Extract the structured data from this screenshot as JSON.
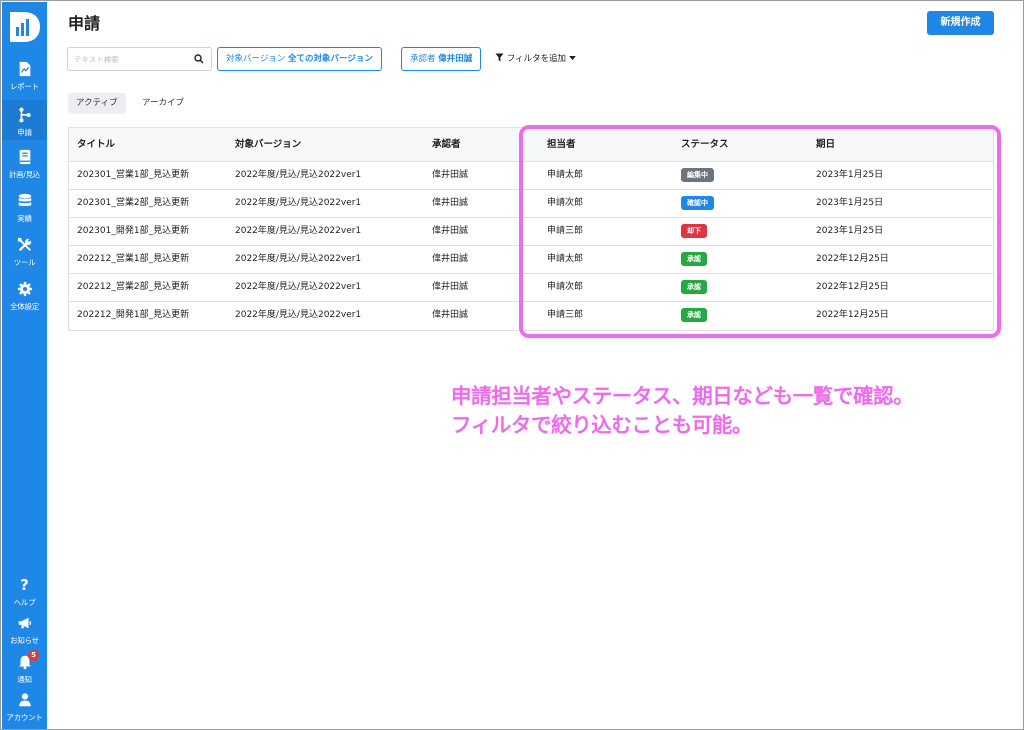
{
  "sidebar": {
    "logo": "D",
    "items": [
      {
        "label": "レポート",
        "icon": "report-icon"
      },
      {
        "label": "申請",
        "icon": "branch-icon",
        "active": true
      },
      {
        "label": "計画/見込",
        "icon": "book-icon"
      },
      {
        "label": "実績",
        "icon": "database-icon"
      },
      {
        "label": "ツール",
        "icon": "tools-icon"
      },
      {
        "label": "全体設定",
        "icon": "gear-icon"
      }
    ],
    "bottom_items": [
      {
        "label": "ヘルプ",
        "icon": "question-icon"
      },
      {
        "label": "お知らせ",
        "icon": "megaphone-icon"
      },
      {
        "label": "通知",
        "icon": "bell-icon",
        "badge": "5"
      },
      {
        "label": "アカウント",
        "icon": "user-icon"
      }
    ]
  },
  "header": {
    "title": "申請",
    "new_button": "新規作成"
  },
  "filters": {
    "search_placeholder": "テキスト検索",
    "target_version_label": "対象バージョン",
    "target_version_value": "全ての対象バージョン",
    "approver_label": "承認者",
    "approver_value": "偉井田誠",
    "add_filter": "フィルタを追加"
  },
  "tabs": [
    {
      "label": "アクティブ",
      "active": true
    },
    {
      "label": "アーカイブ",
      "active": false
    }
  ],
  "table": {
    "headers": [
      "タイトル",
      "対象バージョン",
      "承認者",
      "担当者",
      "ステータス",
      "期日"
    ],
    "rows": [
      {
        "title": "202301_営業1部_見込更新",
        "version": "2022年度/見込/見込2022ver1",
        "approver": "偉井田誠",
        "assignee": "申請太郎",
        "status": "編集中",
        "status_color": "#6c757d",
        "due": "2023年1月25日"
      },
      {
        "title": "202301_営業2部_見込更新",
        "version": "2022年度/見込/見込2022ver1",
        "approver": "偉井田誠",
        "assignee": "申請次郎",
        "status": "確認中",
        "status_color": "#1f87e5",
        "due": "2023年1月25日"
      },
      {
        "title": "202301_開発1部_見込更新",
        "version": "2022年度/見込/見込2022ver1",
        "approver": "偉井田誠",
        "assignee": "申請三郎",
        "status": "却下",
        "status_color": "#dc3545",
        "due": "2023年1月25日"
      },
      {
        "title": "202212_営業1部_見込更新",
        "version": "2022年度/見込/見込2022ver1",
        "approver": "偉井田誠",
        "assignee": "申請太郎",
        "status": "承認",
        "status_color": "#28a745",
        "due": "2022年12月25日"
      },
      {
        "title": "202212_営業2部_見込更新",
        "version": "2022年度/見込/見込2022ver1",
        "approver": "偉井田誠",
        "assignee": "申請次郎",
        "status": "承認",
        "status_color": "#28a745",
        "due": "2022年12月25日"
      },
      {
        "title": "202212_開発1部_見込更新",
        "version": "2022年度/見込/見込2022ver1",
        "approver": "偉井田誠",
        "assignee": "申請三郎",
        "status": "承認",
        "status_color": "#28a745",
        "due": "2022年12月25日"
      }
    ]
  },
  "annotation": {
    "line1": "申請担当者やステータス、期日なども一覧で確認。",
    "line2": "フィルタで絞り込むことも可能。",
    "color": "#ec6cec"
  },
  "colors": {
    "primary": "#1f87e5",
    "highlight": "#ec6cec"
  }
}
